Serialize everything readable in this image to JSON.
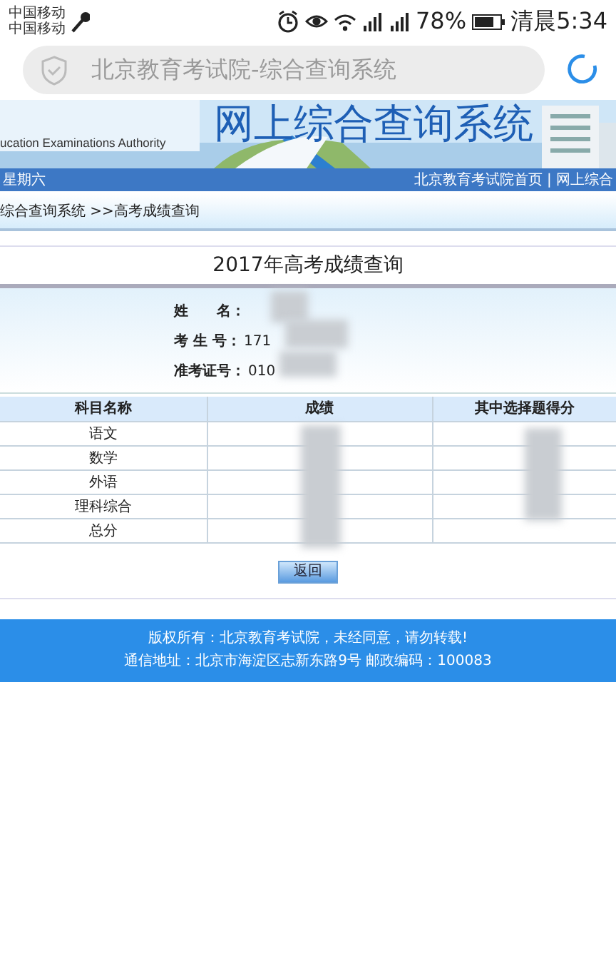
{
  "status_bar": {
    "carriers": [
      "中国移动",
      "中国移动"
    ],
    "battery": "78%",
    "time": "清晨5:34"
  },
  "address_bar": {
    "title": "北京教育考试院-综合查询系统",
    "loading": true
  },
  "banner": {
    "title": "网上综合查询系统",
    "subtitle": "ucation Examinations Authority"
  },
  "nav_bar": {
    "date": "星期六",
    "links": "北京教育考试院首页 | 网上综合"
  },
  "breadcrumb": "综合查询系统 >>高考成绩查询",
  "panel": {
    "title": "2017年高考成绩查询",
    "fields": [
      {
        "label": "姓　　名："
      },
      {
        "label": "考 生 号：",
        "value": "171"
      },
      {
        "label": "准考证号：",
        "value": "010"
      }
    ]
  },
  "table": {
    "columns": [
      "科目名称",
      "成绩",
      "其中选择题得分"
    ],
    "rows": [
      {
        "subject": "语文"
      },
      {
        "subject": "数学"
      },
      {
        "subject": "外语"
      },
      {
        "subject": "理科综合"
      },
      {
        "subject": "总分"
      }
    ]
  },
  "button": "返回",
  "footer": [
    "版权所有：北京教育考试院，未经同意，请勿转载!",
    "通信地址：北京市海淀区志新东路9号 邮政编码：100083"
  ]
}
